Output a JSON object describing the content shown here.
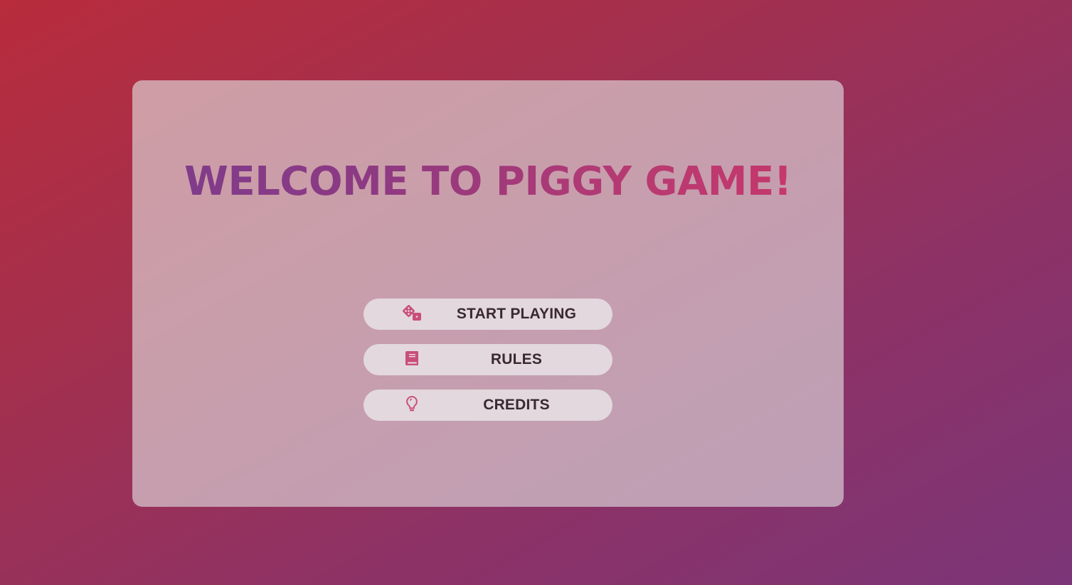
{
  "page": {
    "title": "WELCOME TO PIGGY GAME!"
  },
  "menu": {
    "items": [
      {
        "label": "START PLAYING",
        "icon": "dice-icon"
      },
      {
        "label": "RULES",
        "icon": "book-icon"
      },
      {
        "label": "CREDITS",
        "icon": "lightbulb-icon"
      }
    ]
  },
  "colors": {
    "background_start": "#b82c3c",
    "background_end": "#7b3578",
    "title_gradient_start": "#7c3c8c",
    "title_gradient_end": "#c9376a",
    "icon_color": "#c94e78",
    "button_text": "#3a2a30"
  }
}
